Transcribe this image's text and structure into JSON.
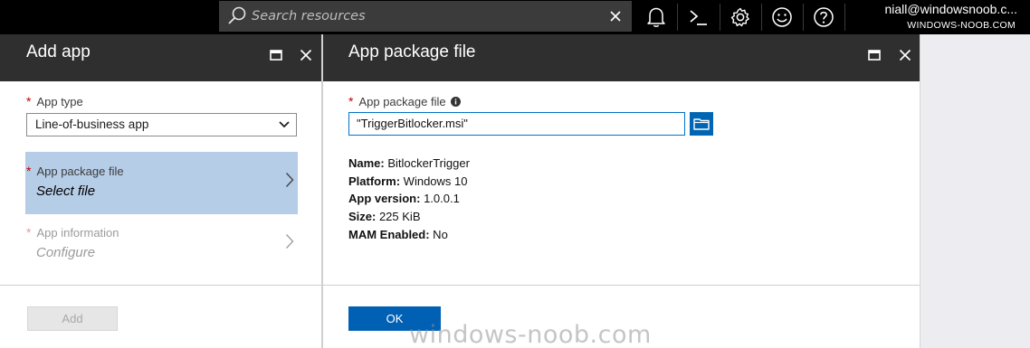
{
  "topbar": {
    "search_placeholder": "Search resources",
    "account_name": "niall@windowsnoob.c...",
    "account_tenant": "WINDOWS-NOOB.COM"
  },
  "left_blade": {
    "title": "Add app",
    "app_type_label": "App type",
    "app_type_value": "Line-of-business app",
    "package_item_label": "App package file",
    "package_item_value": "Select file",
    "info_item_label": "App information",
    "info_item_value": "Configure",
    "add_button": "Add",
    "required_mark": "*"
  },
  "right_blade": {
    "title": "App package file",
    "field_label": "App package file",
    "field_value": "\"TriggerBitlocker.msi\"",
    "details": [
      {
        "key": "Name:",
        "value": " BitlockerTrigger"
      },
      {
        "key": "Platform:",
        "value": " Windows 10"
      },
      {
        "key": "App version:",
        "value": " 1.0.0.1"
      },
      {
        "key": "Size:",
        "value": " 225 KiB"
      },
      {
        "key": "MAM Enabled:",
        "value": " No"
      }
    ],
    "ok_button": "OK"
  },
  "watermark": "windows-noob.com",
  "icons": [
    "search-icon",
    "close-icon",
    "bell-icon",
    "cloud-shell-icon",
    "gear-icon",
    "smiley-icon",
    "help-icon",
    "maximize-icon",
    "folder-icon",
    "chevron-down-icon",
    "chevron-right-icon",
    "info-icon"
  ],
  "colors": {
    "topbar": "#000000",
    "header": "#2f2f2f",
    "selected_item": "#b6cde7",
    "accent": "#0060b4",
    "required": "#c40000"
  }
}
